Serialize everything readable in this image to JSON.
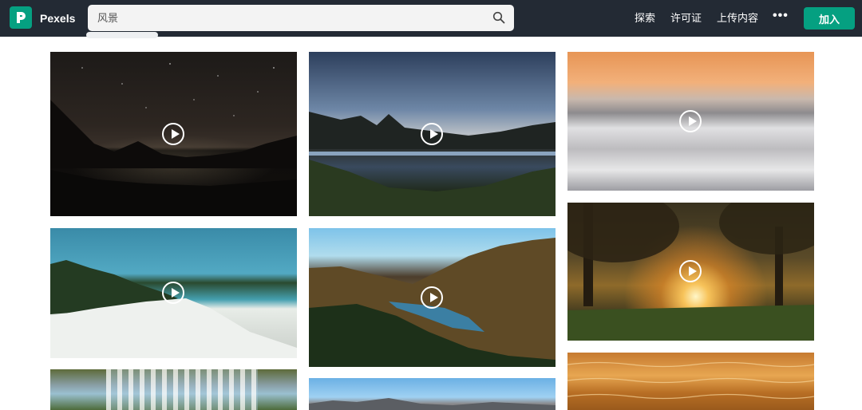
{
  "brand": {
    "name": "Pexels",
    "accent": "#05a081"
  },
  "search": {
    "query": "风景",
    "icon": "search-icon"
  },
  "nav": {
    "explore": "探索",
    "license": "许可证",
    "upload": "上传内容",
    "more": "•••",
    "join": "加入"
  },
  "colors": {
    "topbar": "#232a34",
    "search_bg": "#f3f3f3"
  },
  "videos": [
    {
      "name": "starry-night-lake",
      "icon": "play-icon"
    },
    {
      "name": "mountain-lake-dusk",
      "icon": "play-icon"
    },
    {
      "name": "sea-of-clouds-sunset",
      "icon": "play-icon"
    },
    {
      "name": "tropical-beach",
      "icon": "play-icon"
    },
    {
      "name": "autumn-forest-valley",
      "icon": "play-icon"
    },
    {
      "name": "sunlight-through-trees",
      "icon": "play-icon"
    },
    {
      "name": "waterfall",
      "icon": ""
    },
    {
      "name": "snowy-mountains",
      "icon": ""
    },
    {
      "name": "golden-water-waves",
      "icon": ""
    }
  ]
}
